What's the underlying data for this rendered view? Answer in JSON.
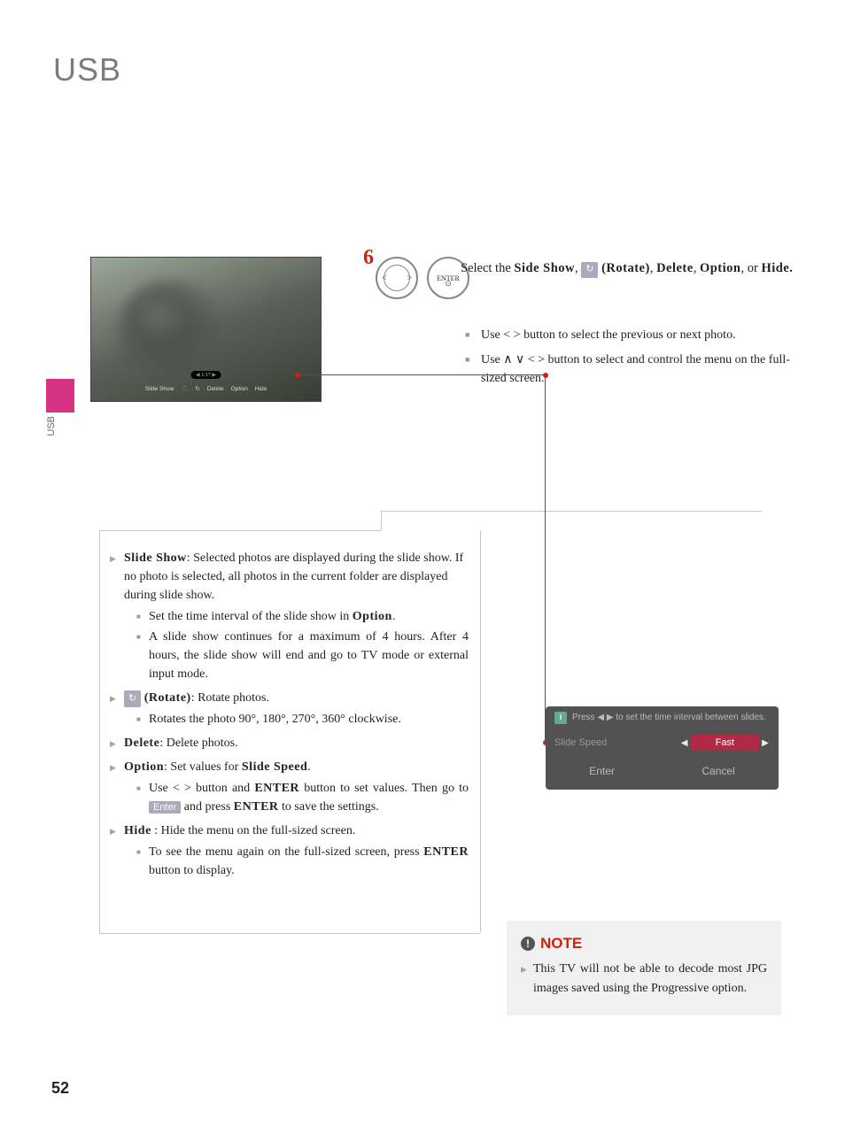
{
  "page": {
    "title": "USB",
    "number": "52",
    "side_tab": "USB",
    "step_number": "6"
  },
  "screenshot": {
    "counter": "1/17",
    "toolbar": [
      "Slide Show",
      "🎵",
      "↻",
      "Delete",
      "Option",
      "Hide"
    ]
  },
  "step": {
    "line1_pre": "Select the ",
    "line1_bold1": "Side Show",
    "line1_sep1": ", ",
    "line1_rotate_label": "↻",
    "line1_bold_rot": "(Rotate)",
    "line1_sep2": ", ",
    "line1_bold2": "Delete",
    "line1_sep3": ", ",
    "line1_bold3": "Option",
    "line1_sep4": ", or ",
    "line1_bold4": "Hide."
  },
  "step_bullets": [
    "Use   <   >   button to select the previous or next photo.",
    "Use   ∧  ∨  <   >   button to select and control the menu on the full-sized screen."
  ],
  "items": {
    "slide_show": {
      "head": "Slide Show",
      "body": ": Selected photos are displayed during the slide show. If no photo is selected, all photos in the cur­rent folder are displayed during slide show.",
      "subs_pre": "Set the time interval of the slide show in ",
      "subs_bold": "Option",
      "subs_post": ".",
      "sub2": "A slide show continues for a maximum of 4 hours. After 4 hours, the slide show will end and go to TV mode or external input mode."
    },
    "rotate": {
      "icon": "↻",
      "head": "(Rotate)",
      "body": ": Rotate photos.",
      "sub": "Rotates the photo 90°, 180°, 270°, 360° clockwise."
    },
    "delete": {
      "head": "Delete",
      "body": ": Delete photos."
    },
    "option": {
      "head": "Option",
      "body_pre": ": Set values for ",
      "body_bold": "Slide Speed",
      "body_post": ".",
      "sub_pre": "Use  <   >  button and ",
      "sub_b1": "ENTER",
      "sub_mid": " button to set values. Then go to ",
      "sub_tag": "Enter",
      "sub_mid2": " and press ",
      "sub_b2": "ENTER",
      "sub_post": " to save the set­tings."
    },
    "hide": {
      "head": "Hide",
      "body": " : Hide the menu on the full-sized screen.",
      "sub_pre": "To see the menu again on the full-sized screen, press ",
      "sub_bold": "ENTER",
      "sub_post": " button to display."
    }
  },
  "option_box": {
    "info_pre": "Press ",
    "info_post": " to set the time interval between slides.",
    "speed_label": "Slide Speed",
    "speed_value": "Fast",
    "btn_enter": "Enter",
    "btn_cancel": "Cancel"
  },
  "note": {
    "title": "NOTE",
    "text": "This TV will not be able to decode most JPG images saved using the Progressive option."
  },
  "remote": {
    "enter": "ENTER",
    "left": "<",
    "right": ">"
  }
}
